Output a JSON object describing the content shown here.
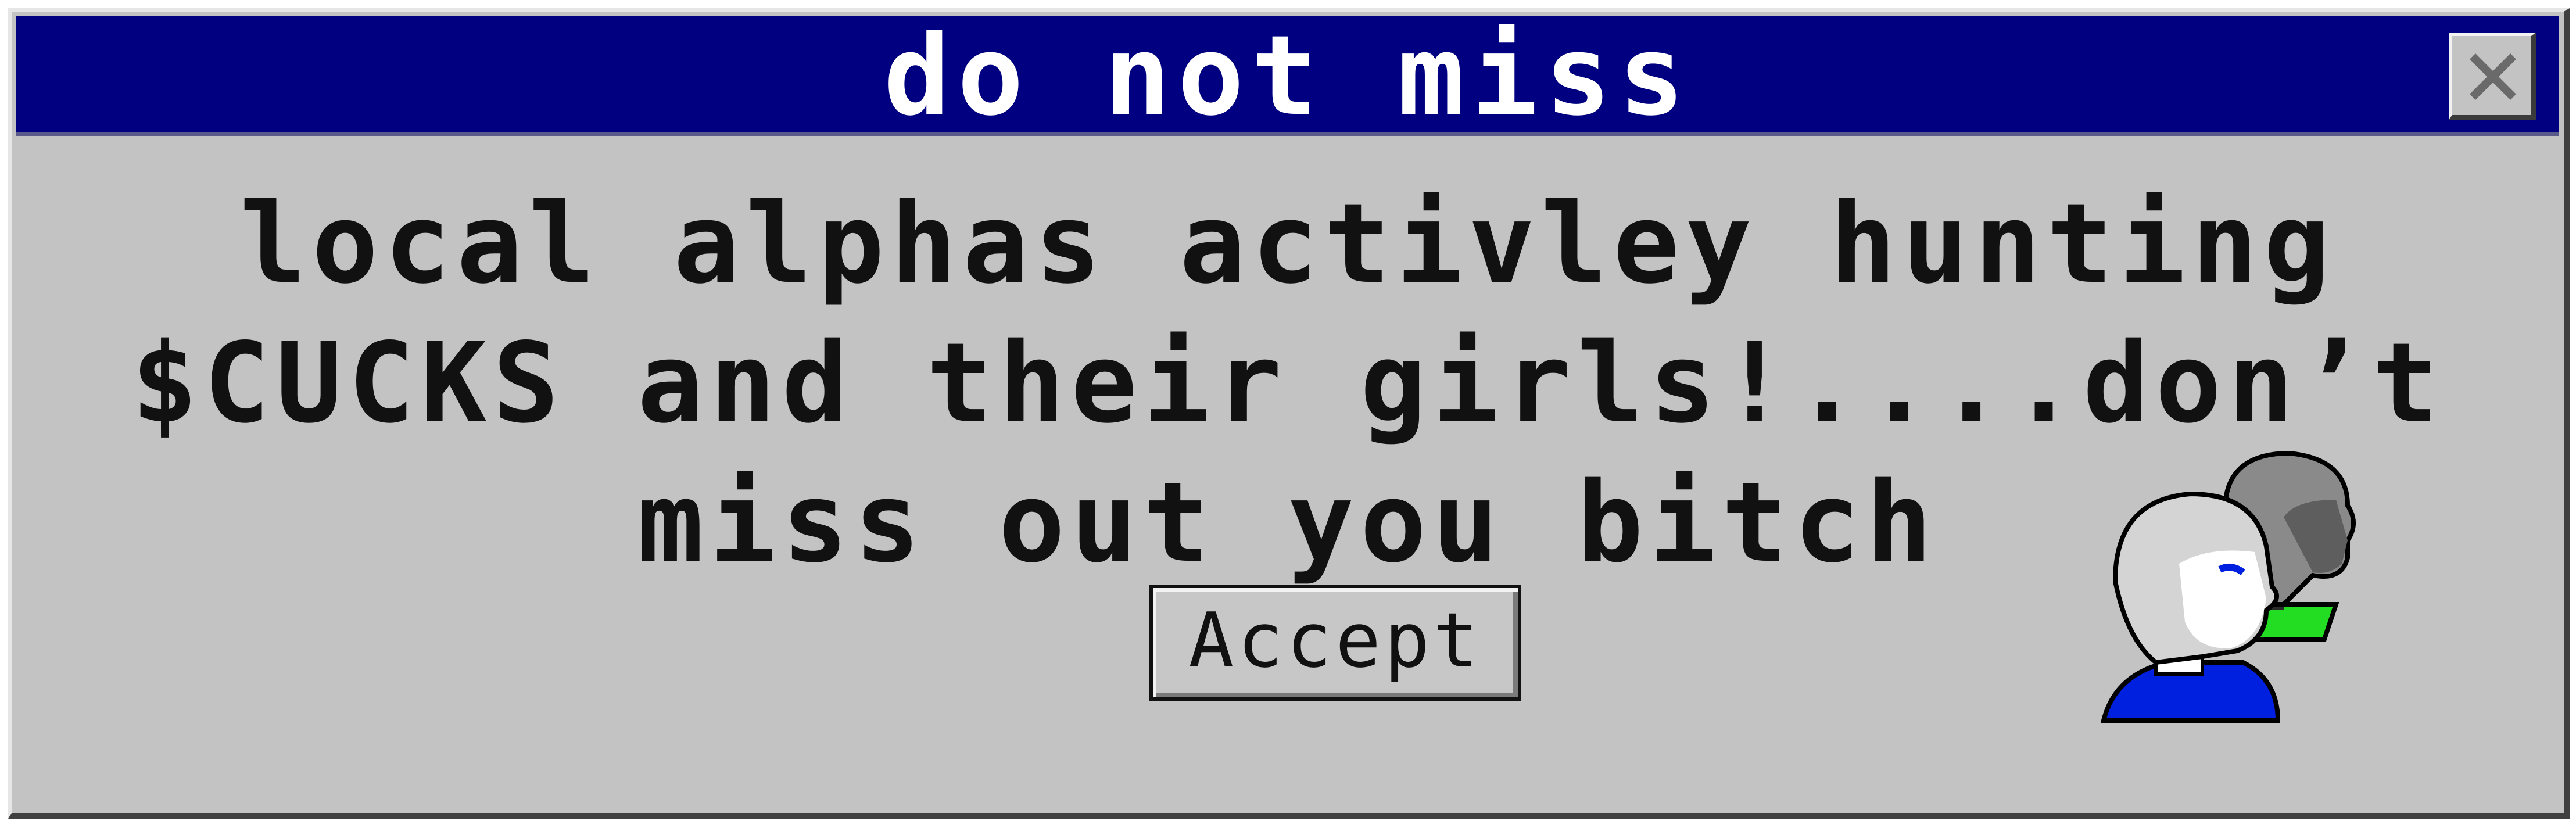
{
  "window": {
    "title": "do not miss"
  },
  "message": {
    "text": "local alphas activley hunting $CUCKS and their girls!....don’t miss out you bitch"
  },
  "buttons": {
    "accept_label": "Accept"
  },
  "icons": {
    "close": "close-icon",
    "users": "users-icon"
  },
  "colors": {
    "titlebar": "#000080",
    "dialog_background": "#c3c3c3",
    "title_text": "#ffffff",
    "message_text": "#111111"
  }
}
